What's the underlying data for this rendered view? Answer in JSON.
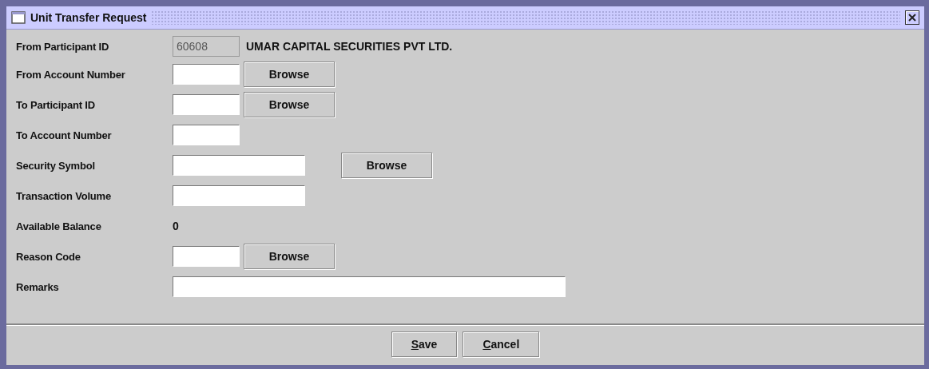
{
  "window": {
    "title": "Unit Transfer Request"
  },
  "rows": [
    {
      "label": "From Participant ID",
      "kind": "participant",
      "value": "60608",
      "disabled": true,
      "name": "UMAR CAPITAL SECURITIES PVT LTD."
    },
    {
      "label": "From Account Number",
      "kind": "lookup",
      "button": "Browse"
    },
    {
      "label": "To Participant ID",
      "kind": "lookup",
      "button": "Browse"
    },
    {
      "label": "To Account Number",
      "kind": "code"
    },
    {
      "label": "Security Symbol",
      "kind": "symbol_lookup",
      "button": "Browse"
    },
    {
      "label": "Transaction Volume",
      "kind": "amount"
    },
    {
      "label": "Available Balance",
      "kind": "display",
      "value": "0"
    },
    {
      "label": "Reason Code",
      "kind": "lookup",
      "button": "Browse"
    },
    {
      "label": "Remarks",
      "kind": "note"
    }
  ],
  "buttons": [
    "Save",
    "Cancel"
  ]
}
